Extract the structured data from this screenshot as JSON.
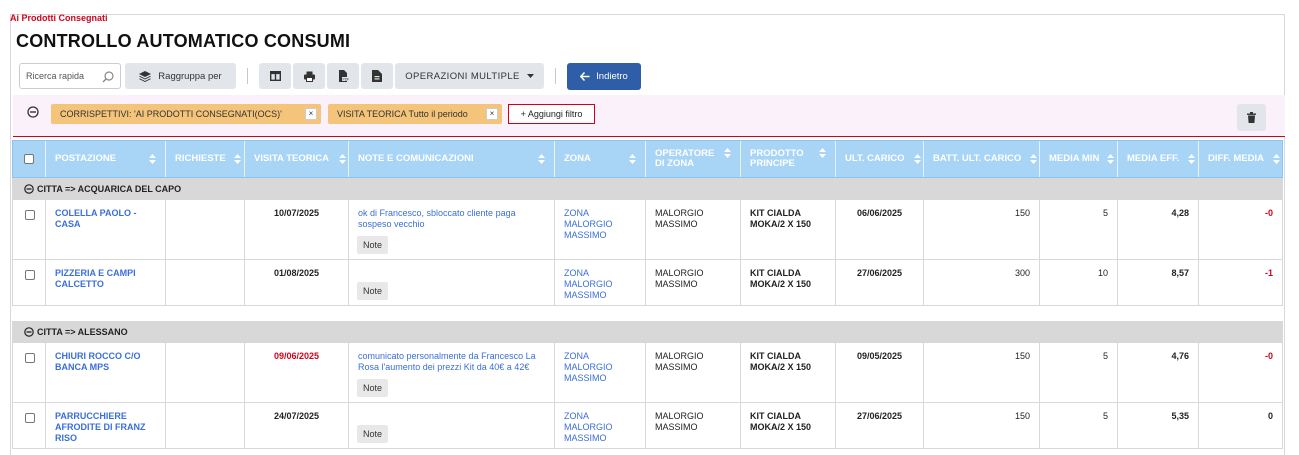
{
  "breadcrumb": "Ai Prodotti Consegnati",
  "title": "CONTROLLO AUTOMATICO CONSUMI",
  "toolbar": {
    "search_placeholder": "Ricerca rapida",
    "group_by_label": "Raggruppa per",
    "multiple_ops_label": "OPERAZIONI MULTIPLE",
    "back_label": "Indietro"
  },
  "filters": {
    "chips": [
      "CORRISPETTIVI: 'AI PRODOTTI CONSEGNATI(OCS)'",
      "VISITA TEORICA Tutto il periodo"
    ],
    "remove_symbol": "×",
    "add_label": "+ Aggiungi filtro"
  },
  "columns": [
    "POSTAZIONE",
    "RICHIESTE",
    "VISITA TEORICA",
    "NOTE E COMUNICAZIONI",
    "ZONA",
    "OPERATORE DI ZONA",
    "PRODOTTO PRINCIPE",
    "ULT. CARICO",
    "BATT. ULT. CARICO",
    "MEDIA MIN",
    "MEDIA EFF.",
    "DIFF. MEDIA"
  ],
  "note_button_label": "Note",
  "groups": [
    {
      "label": "CITTA => ACQUARICA DEL CAPO",
      "rows": [
        {
          "postazione": "COLELLA PAOLO - CASA",
          "richieste": "",
          "visita": "10/07/2025",
          "visita_overdue": false,
          "note": "ok di Francesco, sbloccato cliente paga sospeso vecchio",
          "zona": "ZONA MALORGIO MASSIMO",
          "operatore": "MALORGIO MASSIMO",
          "prodotto": "KIT CIALDA MOKA/2 X 150",
          "ult_carico": "06/06/2025",
          "batt": "150",
          "media_min": "5",
          "media_eff": "4,28",
          "diff": "-0",
          "diff_negative": true
        },
        {
          "postazione": "PIZZERIA E CAMPI CALCETTO",
          "richieste": "",
          "visita": "01/08/2025",
          "visita_overdue": false,
          "note": "",
          "zona": "ZONA MALORGIO MASSIMO",
          "operatore": "MALORGIO MASSIMO",
          "prodotto": "KIT CIALDA MOKA/2 X 150",
          "ult_carico": "27/06/2025",
          "batt": "300",
          "media_min": "10",
          "media_eff": "8,57",
          "diff": "-1",
          "diff_negative": true
        }
      ]
    },
    {
      "label": "CITTA => ALESSANO",
      "rows": [
        {
          "postazione": "CHIURI ROCCO C/O BANCA MPS",
          "richieste": "",
          "visita": "09/06/2025",
          "visita_overdue": true,
          "note": "comunicato personalmente da Francesco La Rosa l'aumento dei prezzi Kit da 40€ a 42€",
          "zona": "ZONA MALORGIO MASSIMO",
          "operatore": "MALORGIO MASSIMO",
          "prodotto": "KIT CIALDA MOKA/2 X 150",
          "ult_carico": "09/05/2025",
          "batt": "150",
          "media_min": "5",
          "media_eff": "4,76",
          "diff": "-0",
          "diff_negative": true
        },
        {
          "postazione": "PARRUCCHIERE AFRODITE DI FRANZ RISO",
          "richieste": "",
          "visita": "24/07/2025",
          "visita_overdue": false,
          "note": "",
          "zona": "ZONA MALORGIO MASSIMO",
          "operatore": "MALORGIO MASSIMO",
          "prodotto": "KIT CIALDA MOKA/2 X 150",
          "ult_carico": "27/06/2025",
          "batt": "150",
          "media_min": "5",
          "media_eff": "5,35",
          "diff": "0",
          "diff_negative": false
        }
      ]
    }
  ],
  "colors": {
    "accent": "#2f5ea8",
    "header": "#a8d4f6",
    "alert": "#d0021b",
    "chip": "#f4c47a",
    "link": "#3a6fd8"
  }
}
